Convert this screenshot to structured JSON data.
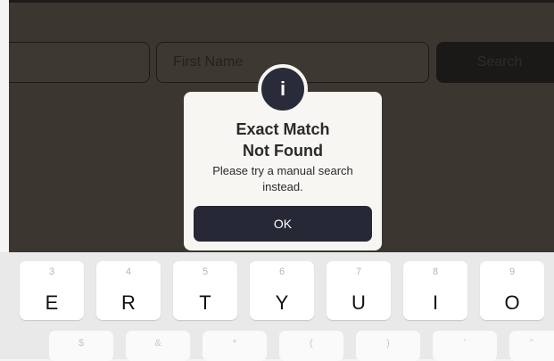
{
  "form": {
    "first_name_placeholder": "First Name",
    "search_label": "Search"
  },
  "dialog": {
    "icon_glyph": "i",
    "title_line1": "Exact Match",
    "title_line2": "Not Found",
    "message_line1": "Please try a manual search",
    "message_line2": "instead.",
    "ok_label": "OK"
  },
  "keyboard": {
    "letters": [
      "E",
      "R",
      "T",
      "Y",
      "U",
      "I",
      "O"
    ],
    "numbers": [
      "3",
      "4",
      "5",
      "6",
      "7",
      "8",
      "9"
    ],
    "symbols": [
      "$",
      "&",
      "*",
      "(",
      ")",
      "'",
      "\""
    ]
  }
}
